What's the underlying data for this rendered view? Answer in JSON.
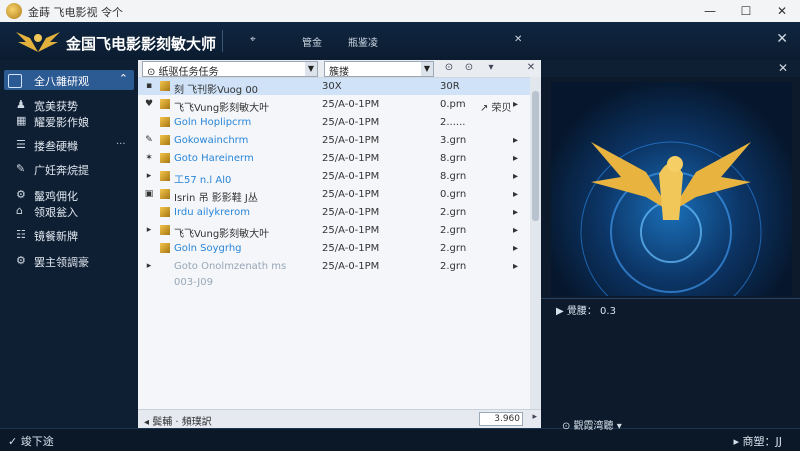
{
  "window": {
    "title": "金蒔 飞电影视 令个",
    "minimize": "—",
    "maximize": "☐",
    "close": "✕"
  },
  "header": {
    "brand": "金国飞电影影刻敏大师",
    "items": [
      "⌖",
      "管金",
      "瓶鉴凌"
    ],
    "close": "✕",
    "more": "✕"
  },
  "sidebar": {
    "active": {
      "label": "全八雜研观",
      "icon": "grid-icon"
    },
    "items": [
      {
        "label": "宽美获势",
        "icon": "person-icon"
      },
      {
        "label": "耀爱影作娘",
        "icon": "film-icon"
      },
      {
        "label": "搂叁硬橼",
        "icon": "list-icon",
        "dots": "···"
      },
      {
        "label": "广妊奔烷提",
        "icon": "edit-icon"
      },
      {
        "label": "鬣鸡佣化",
        "icon": "gear-icon"
      },
      {
        "label": "领艰瓮入",
        "icon": "home-icon"
      },
      {
        "label": "镜餐新牌",
        "icon": "users-icon"
      },
      {
        "label": "罢主领調豪",
        "icon": "settings-icon"
      }
    ]
  },
  "toolbar": {
    "path": "⊙ 纸驱任务任务",
    "filter": "簇搂",
    "btn1": "⊙",
    "btn2": "⊙",
    "btn3": "▾",
    "close": "✕"
  },
  "rows": [
    {
      "icon": "▪",
      "name": "刻 飞刊影Vuog 00",
      "date": "30X",
      "size": "30R",
      "action": "",
      "end": "",
      "style": "hl"
    },
    {
      "icon": "♥",
      "name": "飞飞Vung影刻敏大叶",
      "date": "25/A-0-1PM",
      "size": "0.pm",
      "action": "↗ 荣贝",
      "end": "▸",
      "style": ""
    },
    {
      "icon": "",
      "name": "Goln Hoplipcrm",
      "date": "25/A-0-1PM",
      "size": "2......",
      "action": "",
      "end": "",
      "style": "sub"
    },
    {
      "icon": "✎",
      "name": "Gokowainchrm",
      "date": "25/A-0-1PM",
      "size": "3.grn",
      "action": "",
      "end": "▸",
      "style": "sub"
    },
    {
      "icon": "✶",
      "name": "Goto Hareinerm",
      "date": "25/A-0-1PM",
      "size": "8.grn",
      "action": "",
      "end": "▸",
      "style": "sub"
    },
    {
      "icon": "▸",
      "name": "工57 n.l Al0",
      "date": "25/A-0-1PM",
      "size": "8.grn",
      "action": "",
      "end": "▸",
      "style": "sub"
    },
    {
      "icon": "▣",
      "name": "Isrin 吊 影影鞋 J丛",
      "date": "25/A-0-1PM",
      "size": "0.grn",
      "action": "",
      "end": "▸",
      "style": ""
    },
    {
      "icon": "",
      "name": "Irdu ailykrerom",
      "date": "25/A-0-1PM",
      "size": "2.grn",
      "action": "",
      "end": "▸",
      "style": "sub"
    },
    {
      "icon": "▸",
      "name": "飞飞Vung影刻敏大叶",
      "date": "25/A-0-1PM",
      "size": "2.grn",
      "action": "",
      "end": "▸",
      "style": ""
    },
    {
      "icon": "",
      "name": "Goln Soygrhg",
      "date": "25/A-0-1PM",
      "size": "2.grn",
      "action": "",
      "end": "▸",
      "style": "sub"
    },
    {
      "icon": "▸",
      "name": "Goto Onolmzenath ms",
      "date": "25/A-0-1PM",
      "size": "2.grn",
      "action": "",
      "end": "▸",
      "style": "muted"
    },
    {
      "icon": "",
      "name": "003-J09",
      "date": "",
      "size": "",
      "action": "",
      "end": "",
      "style": "muted"
    }
  ],
  "panel_bottom": {
    "status": "◂ 鬓輔 · 頻璞訳",
    "left_scroll": "◂",
    "right_scroll": "▸",
    "count": "3.960"
  },
  "preview": {
    "label": "▶ 覺腰： 0.3",
    "top_close": "✕"
  },
  "statusbar": {
    "left": "✓ 竣下途",
    "mid": "⊙ 觀霞湾聽 ▾",
    "right": "▸ 商塑：JJ"
  }
}
